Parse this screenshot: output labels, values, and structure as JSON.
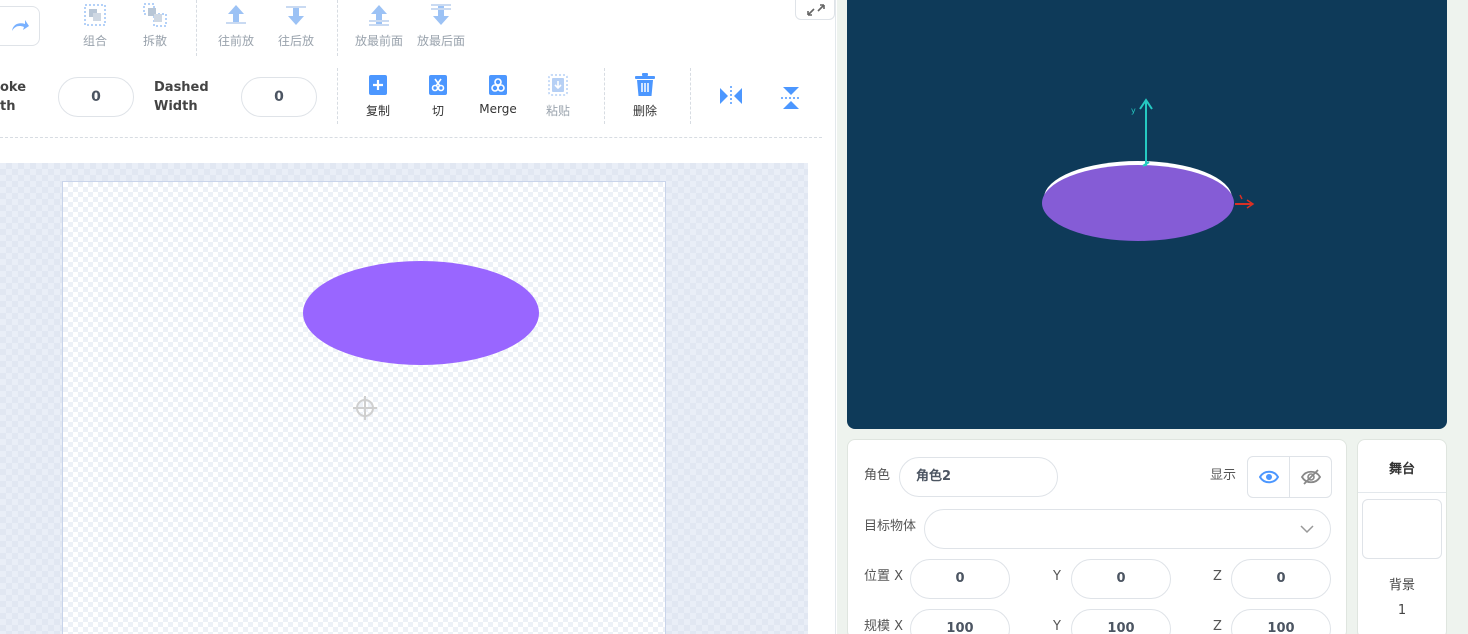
{
  "toolbar": {
    "group_label": "组合",
    "ungroup_label": "拆散",
    "forward_label": "往前放",
    "backward_label": "往后放",
    "front_label": "放最前面",
    "back_label": "放最后面",
    "stroke_width_label_line1": "oke",
    "stroke_width_label_line2": "th",
    "stroke_width_value": "0",
    "dashed_width_label_line1": "Dashed",
    "dashed_width_label_line2": "Width",
    "dashed_width_value": "0",
    "copy_label": "复制",
    "cut_label": "切",
    "merge_label": "Merge",
    "paste_label": "粘贴",
    "delete_label": "删除"
  },
  "colors": {
    "accent": "#4c97ff",
    "shape_fill": "#9966ff",
    "stage_bg": "#0e3a59",
    "stage_shape": "#855cd6"
  },
  "sprite": {
    "name_label": "角色",
    "name_value": "角色2",
    "show_label": "显示",
    "target_label": "目标物体",
    "target_value": "",
    "position_x_label": "位置 X",
    "position_x": "0",
    "y_label": "Y",
    "position_y": "0",
    "z_label": "Z",
    "position_z": "0",
    "scale_x_label": "规模 X",
    "scale_x": "100",
    "scale_y": "100",
    "scale_z": "100"
  },
  "stage_panel": {
    "title": "舞台",
    "backdrop_label": "背景",
    "backdrop_count": "1"
  }
}
